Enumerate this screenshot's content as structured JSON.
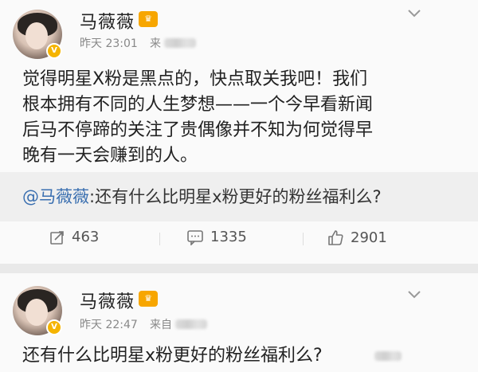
{
  "posts": [
    {
      "author": "马薇薇",
      "time": "昨天 23:01",
      "source_prefix": "来",
      "content_lines": [
        "觉得明星X粉是黑点的，快点取关我吧！我们",
        "根本拥有不同的人生梦想——一个今早看新闻",
        "后马不停蹄的关注了贵偶像并不知为何觉得早",
        "晚有一天会赚到的人。"
      ],
      "repost": {
        "user": "@马薇薇",
        "text": ":还有什么比明星x粉更好的粉丝福利么?"
      },
      "actions": {
        "repost_count": "463",
        "comment_count": "1335",
        "like_count": "2901"
      }
    },
    {
      "author": "马薇薇",
      "time": "昨天 22:47",
      "source_prefix": "来自",
      "content_lines": [
        "还有什么比明星x粉更好的粉丝福利么?"
      ]
    }
  ],
  "icons": {
    "more": "chevron-down-icon",
    "verified": "verified-badge-icon",
    "vip": "vip-crown-icon",
    "repost": "repost-icon",
    "comment": "comment-icon",
    "like": "thumbs-up-icon"
  },
  "colors": {
    "background": "#fafafa",
    "repost_background": "#efefef",
    "link": "#3a6fb0",
    "verified": "#f5b400",
    "vip": "#f7a600"
  }
}
